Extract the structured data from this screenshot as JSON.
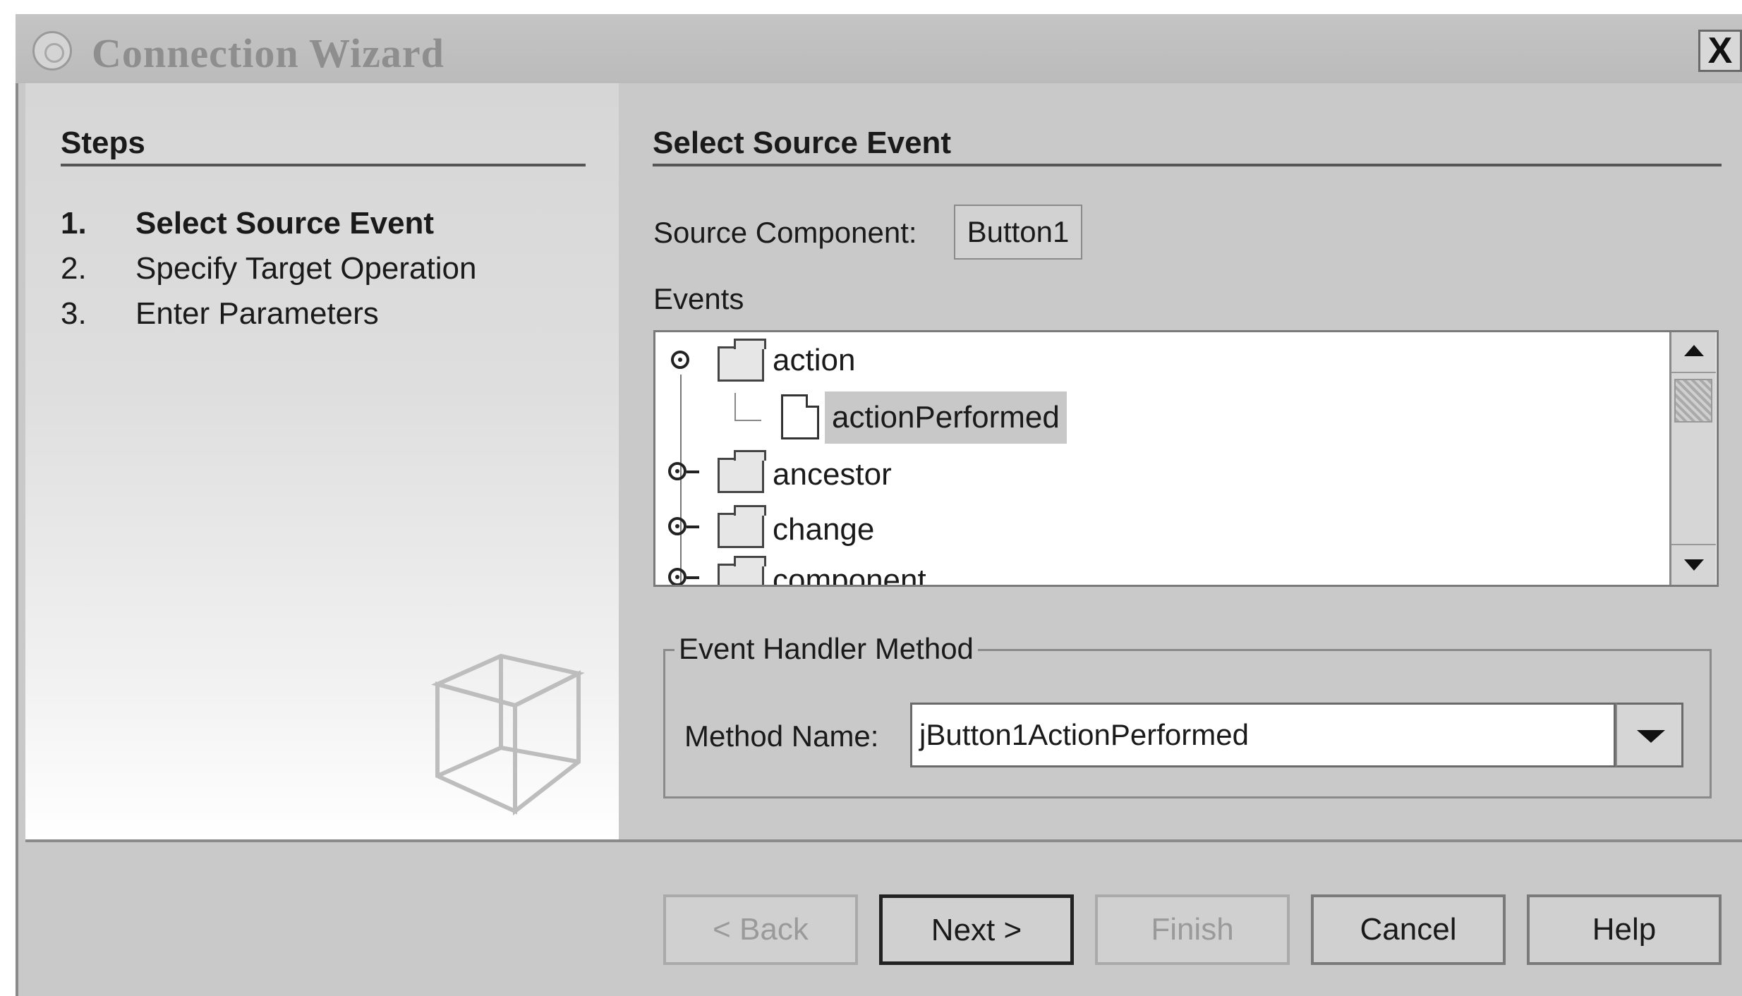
{
  "window": {
    "title": "Connection Wizard",
    "close_label": "X"
  },
  "steps": {
    "heading": "Steps",
    "items": [
      {
        "num": "1.",
        "label": "Select Source Event",
        "active": true
      },
      {
        "num": "2.",
        "label": "Specify Target Operation",
        "active": false
      },
      {
        "num": "3.",
        "label": "Enter Parameters",
        "active": false
      }
    ]
  },
  "main": {
    "heading": "Select Source Event",
    "source_component_label": "Source Component:",
    "source_component_value": "Button1",
    "events_label": "Events",
    "events": [
      {
        "label": "action",
        "expanded": true,
        "children": [
          "actionPerformed"
        ]
      },
      {
        "label": "ancestor",
        "expanded": false
      },
      {
        "label": "change",
        "expanded": false
      },
      {
        "label": "component",
        "expanded": false
      }
    ],
    "selected_event": "actionPerformed"
  },
  "handler": {
    "legend": "Event Handler Method",
    "method_label": "Method Name:",
    "method_value": "jButton1ActionPerformed"
  },
  "buttons": {
    "back": "< Back",
    "next": "Next >",
    "finish": "Finish",
    "cancel": "Cancel",
    "help": "Help"
  },
  "icons": [
    "wizard-app-icon",
    "close-icon",
    "cube-icon",
    "tree-toggle-icon",
    "folder-icon",
    "file-icon",
    "scroll-up-icon",
    "scroll-down-icon",
    "dropdown-arrow-icon"
  ]
}
